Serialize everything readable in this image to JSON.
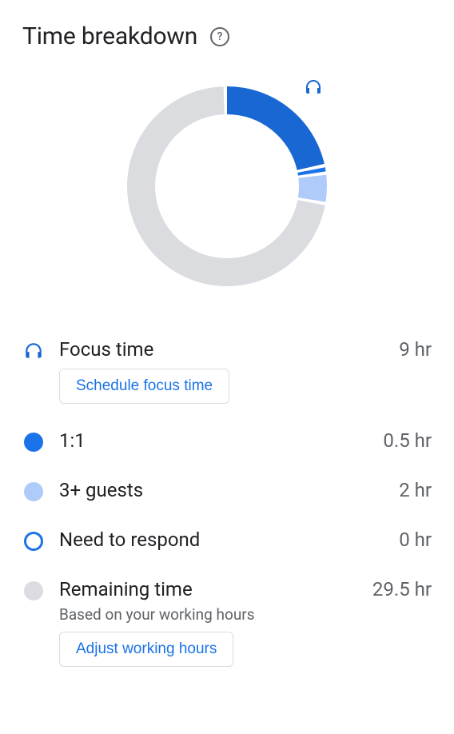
{
  "header": {
    "title": "Time breakdown"
  },
  "legend": {
    "focus": {
      "label": "Focus time",
      "value": "9 hr",
      "action": "Schedule focus time",
      "color": "#1967d2"
    },
    "one_on_one": {
      "label": "1:1",
      "value": "0.5 hr",
      "color": "#1a73e8"
    },
    "guests": {
      "label": "3+ guests",
      "value": "2 hr",
      "color": "#aecbfa"
    },
    "respond": {
      "label": "Need to respond",
      "value": "0 hr",
      "color": "#1a73e8"
    },
    "remaining": {
      "label": "Remaining time",
      "value": "29.5 hr",
      "sublabel": "Based on your working hours",
      "action": "Adjust working hours",
      "color": "#dadce0"
    }
  },
  "chart_data": {
    "type": "pie",
    "title": "Time breakdown",
    "series": [
      {
        "name": "Focus time",
        "value": 9,
        "color": "#1967d2"
      },
      {
        "name": "1:1",
        "value": 0.5,
        "color": "#1a73e8"
      },
      {
        "name": "3+ guests",
        "value": 2,
        "color": "#aecbfa"
      },
      {
        "name": "Need to respond",
        "value": 0,
        "color": "#1a73e8"
      },
      {
        "name": "Remaining time",
        "value": 29.5,
        "color": "#dadce0"
      }
    ],
    "total": 41,
    "unit": "hr"
  }
}
